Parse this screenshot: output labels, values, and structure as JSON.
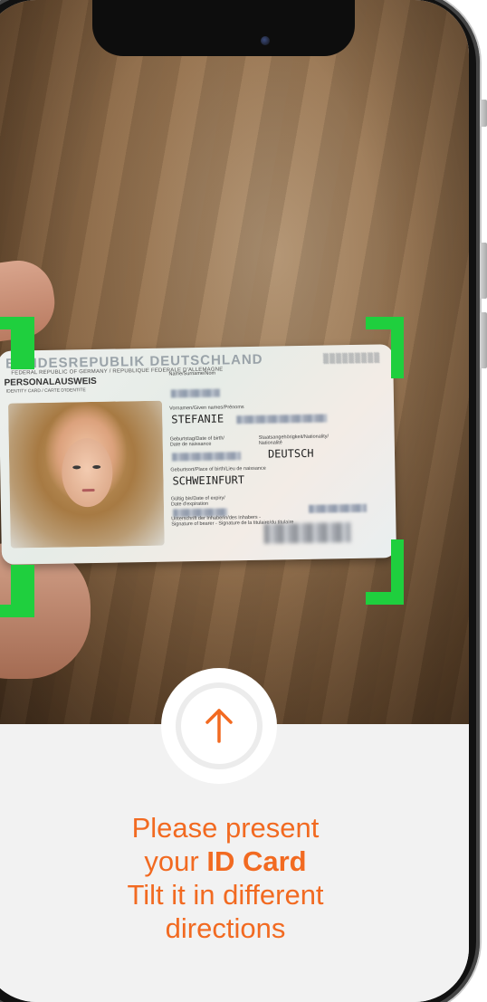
{
  "id_card": {
    "header_country": "BUNDESREPUBLIK DEUTSCHLAND",
    "header_subtitle": "FEDERAL REPUBLIC OF GERMANY / REPUBLIQUE FEDERALE D'ALLEMAGNE",
    "header_type": "PERSONALAUSWEIS",
    "header_type_en": "IDENTITY CARD / CARTE D'IDENTITE",
    "label_surname": "Name/Surname/Nom",
    "label_given_names": "Vornamen/Given names/Prénoms",
    "given_name": "STEFANIE",
    "label_dob": "Geburtstag/Date of birth/\nDate de naissance",
    "label_nationality": "Staatsangehörigkeit/Nationality/\nNationalité",
    "nationality": "DEUTSCH",
    "label_place_of_birth": "Geburtsort/Place of birth/Lieu de naissance",
    "place_of_birth": "SCHWEINFURT",
    "label_expiry": "Gültig bis/Date of expiry/\nDate d'expiration",
    "label_signature": "Unterschrift der Inhaberin/des Inhabers -\nSignature of bearer - Signature de la titulaire/du titulaire"
  },
  "instruction": {
    "line1": "Please present",
    "line2_prefix": "your ",
    "line2_bold": "ID Card",
    "line3": "Tilt it in different",
    "line4": "directions"
  },
  "icons": {
    "arrow": "arrow-up-icon"
  },
  "colors": {
    "accent": "#f26a21",
    "frame_corner": "#1fcf3e",
    "panel_bg": "#f2f2f2"
  }
}
